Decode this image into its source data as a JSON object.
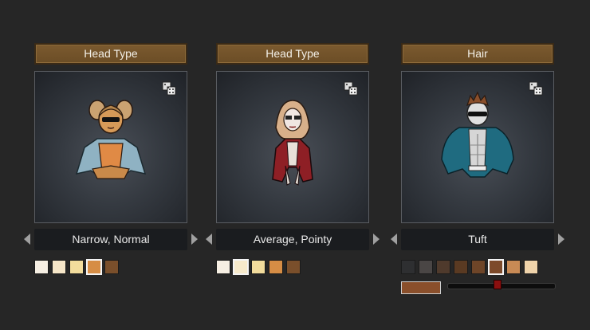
{
  "panels": [
    {
      "header": "Head Type",
      "name": "Narrow, Normal",
      "icons": {
        "randomize": "dice-icon",
        "prev": "arrow-left-icon",
        "next": "arrow-right-icon"
      },
      "swatches": [
        "#f6efe3",
        "#f6e6c8",
        "#f2dc9c",
        "#d68d45",
        "#7a4f2b"
      ],
      "selected_swatch": 3
    },
    {
      "header": "Head Type",
      "name": "Average, Pointy",
      "icons": {
        "randomize": "dice-icon",
        "prev": "arrow-left-icon",
        "next": "arrow-right-icon"
      },
      "swatches": [
        "#f6efe3",
        "#f7eacb",
        "#f2dc9c",
        "#d68d45",
        "#7a4f2b"
      ],
      "selected_swatch": 1
    },
    {
      "header": "Hair",
      "name": "Tuft",
      "icons": {
        "randomize": "dice-icon",
        "prev": "arrow-left-icon",
        "next": "arrow-right-icon"
      },
      "swatches": [
        "#2e2f31",
        "#4a4645",
        "#4f3a2c",
        "#5a3a22",
        "#6e4528",
        "#7d4a2a",
        "#c88a55",
        "#efd3aa"
      ],
      "selected_swatch": 5,
      "custom_color": "#8a4f2b",
      "slider_level": 0.47
    }
  ]
}
